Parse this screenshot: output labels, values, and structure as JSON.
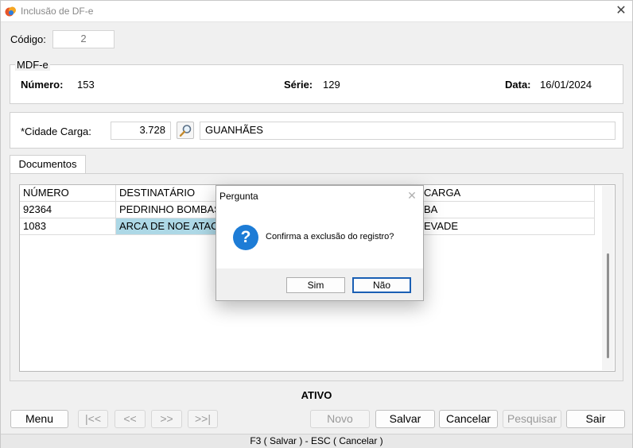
{
  "window": {
    "title": "Inclusão de DF-e",
    "close": "✕"
  },
  "codigo": {
    "label": "Código:",
    "value": "2"
  },
  "mdfe": {
    "legend": "MDF-e",
    "numero_label": "Número:",
    "numero_value": "153",
    "serie_label": "Série:",
    "serie_value": "129",
    "data_label": "Data:",
    "data_value": "16/01/2024"
  },
  "cidade": {
    "label": "*Cidade Carga:",
    "code": "3.728",
    "name": "GUANHÃES"
  },
  "tabs": [
    {
      "label": "Documentos"
    }
  ],
  "table": {
    "headers": [
      "NÚMERO",
      "DESTINATÁRIO",
      "CARGA"
    ],
    "rows": [
      [
        "92364",
        "PEDRINHO BOMBAS",
        "BA"
      ],
      [
        "1083",
        "ARCA DE NOE ATAC",
        "EVADE"
      ]
    ]
  },
  "status_text": "ATIVO",
  "buttons": {
    "menu": "Menu",
    "first": "|<<",
    "prev": "<<",
    "next": ">>",
    "last": ">>|",
    "novo": "Novo",
    "salvar": "Salvar",
    "cancelar": "Cancelar",
    "pesquisar": "Pesquisar",
    "sair": "Sair"
  },
  "footer": "F3 ( Salvar )  -  ESC ( Cancelar )",
  "dialog": {
    "title": "Pergunta",
    "close": "✕",
    "icon": "?",
    "message": "Confirma a exclusão do registro?",
    "yes": "Sim",
    "no": "Não"
  },
  "colors": {
    "accent": "#1d7cd6",
    "selection": "#add8e6",
    "window_bg": "#f0f0f0"
  }
}
